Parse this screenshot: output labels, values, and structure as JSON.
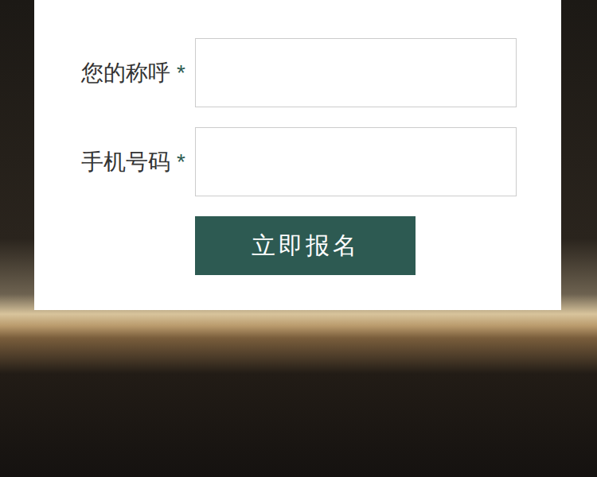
{
  "form": {
    "fields": [
      {
        "label": "您的称呼",
        "required": true,
        "required_mark": "*",
        "value": ""
      },
      {
        "label": "手机号码",
        "required": true,
        "required_mark": "*",
        "value": ""
      }
    ],
    "submit": {
      "label": "立即报名"
    }
  }
}
